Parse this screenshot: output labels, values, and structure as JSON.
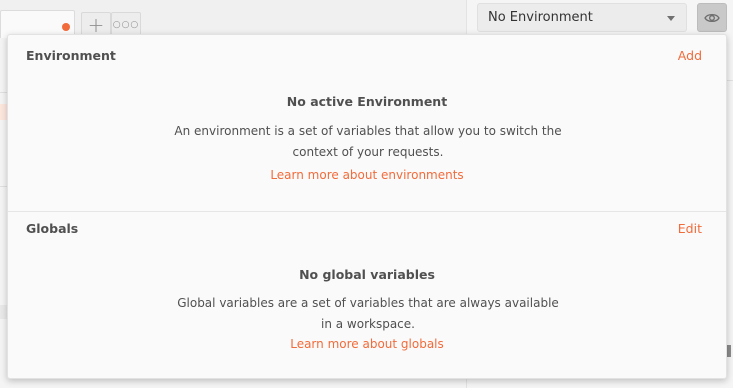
{
  "header": {
    "environment_select": {
      "value": "No Environment"
    }
  },
  "popup": {
    "environment": {
      "title": "Environment",
      "action": "Add",
      "empty_title": "No active Environment",
      "empty_body": "An environment is a set of variables that allow you to switch the context of your requests.",
      "link": "Learn more about environments"
    },
    "globals": {
      "title": "Globals",
      "action": "Edit",
      "empty_title": "No global variables",
      "empty_body": "Global variables are a set of variables that are always available in a workspace.",
      "link": "Learn more about globals"
    }
  },
  "colors": {
    "accent": "#f26b3a",
    "text": "#505050",
    "popup_bg": "#fafafa"
  },
  "icons": [
    "plus-icon",
    "more-icon",
    "chevron-down-icon",
    "eye-icon"
  ]
}
